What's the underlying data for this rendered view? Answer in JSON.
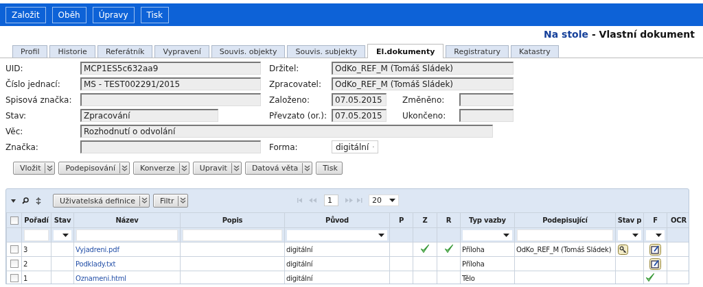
{
  "toolbar": {
    "buttons": [
      "Založit",
      "Oběh",
      "Úpravy",
      "Tisk"
    ]
  },
  "heading": {
    "context": "Na stole",
    "separator": "-",
    "title": "Vlastní dokument"
  },
  "tabs": [
    {
      "label": "Profil",
      "selected": false
    },
    {
      "label": "Historie",
      "selected": false
    },
    {
      "label": "Referátník",
      "selected": false
    },
    {
      "label": "Vypravení",
      "selected": false
    },
    {
      "label": "Souvis. objekty",
      "selected": false
    },
    {
      "label": "Souvis. subjekty",
      "selected": false
    },
    {
      "label": "El.dokumenty",
      "selected": true
    },
    {
      "label": "Registratury",
      "selected": false
    },
    {
      "label": "Katastry",
      "selected": false
    }
  ],
  "form": {
    "rows": [
      [
        {
          "label": "UID:",
          "value": "MCP1ES5c632aa9",
          "kind": "text"
        },
        {
          "label": "Držitel:",
          "value": "OdKo_REF_M (Tomáš Sládek)",
          "kind": "text"
        }
      ],
      [
        {
          "label": "Číslo jednací:",
          "value": "MS - TEST002291/2015",
          "kind": "text"
        },
        {
          "label": "Zpracovatel:",
          "value": "OdKo_REF_M (Tomáš Sládek)",
          "kind": "text"
        }
      ],
      [
        {
          "label": "Spisová značka:",
          "kind": "text"
        },
        {
          "label": "Založeno:",
          "value": "07.05.2015",
          "kind": "text"
        },
        {
          "label": "Změněno:",
          "kind": "text"
        }
      ],
      [
        {
          "label": "Stav:",
          "value": "Zpracování",
          "kind": "text"
        },
        {
          "label": "Převzato (or.):",
          "value": "07.05.2015",
          "kind": "text"
        },
        {
          "label": "Ukončeno:",
          "kind": "text"
        }
      ],
      [
        {
          "label": "Věc:",
          "value": "Rozhodnutí o odvolání",
          "kind": "text"
        }
      ],
      [
        {
          "label": "Značka:",
          "kind": "text"
        },
        {
          "label": "Forma:",
          "value": "digitální",
          "kind": "select"
        }
      ]
    ]
  },
  "actions": [
    {
      "label": "Vložit",
      "kind": "split"
    },
    {
      "label": "Podepisování",
      "kind": "split"
    },
    {
      "label": "Konverze",
      "kind": "split"
    },
    {
      "label": "Upravit",
      "kind": "split"
    },
    {
      "label": "Datová věta",
      "kind": "split"
    },
    {
      "label": "Tisk",
      "kind": "plain"
    }
  ],
  "grid": {
    "tools": [
      {
        "label": "Uživatelská definice",
        "kind": "split"
      },
      {
        "label": "Filtr",
        "kind": "split"
      }
    ],
    "page": "1",
    "page_size": "20",
    "header_checked": false,
    "columns": [
      {
        "label": "Pořadí",
        "kind": "text"
      },
      {
        "label": "Stav",
        "kind": "select"
      },
      {
        "label": "Název",
        "kind": "text"
      },
      {
        "label": "Popis",
        "kind": "text"
      },
      {
        "label": "Původ",
        "kind": "select"
      },
      {
        "label": "P",
        "kind": "none"
      },
      {
        "label": "Z",
        "kind": "none"
      },
      {
        "label": "R",
        "kind": "none"
      },
      {
        "label": "Typ vazby",
        "kind": "select"
      },
      {
        "label": "Podepisující",
        "kind": "text"
      },
      {
        "label": "Stav p",
        "kind": "select"
      },
      {
        "label": "F",
        "kind": "select"
      },
      {
        "label": "OCR",
        "kind": "none"
      }
    ],
    "rows": [
      {
        "checked": false,
        "order": "3",
        "name": "Vyjadreni.pdf",
        "origin": "digitální",
        "z": true,
        "r": true,
        "link_type": "Příloha",
        "signer": "OdKo_REF_M (Tomáš Sládek)",
        "signing": true,
        "kind": "edit"
      },
      {
        "checked": false,
        "order": "2",
        "name": "Podklady.txt",
        "origin": "digitální",
        "z": false,
        "r": false,
        "link_type": "Příloha",
        "signing": false,
        "kind": "edit"
      },
      {
        "checked": false,
        "order": "1",
        "name": "Oznameni.html",
        "origin": "digitální",
        "z": false,
        "r": false,
        "link_type": "Tělo",
        "signing": false,
        "kind": "check"
      }
    ]
  }
}
